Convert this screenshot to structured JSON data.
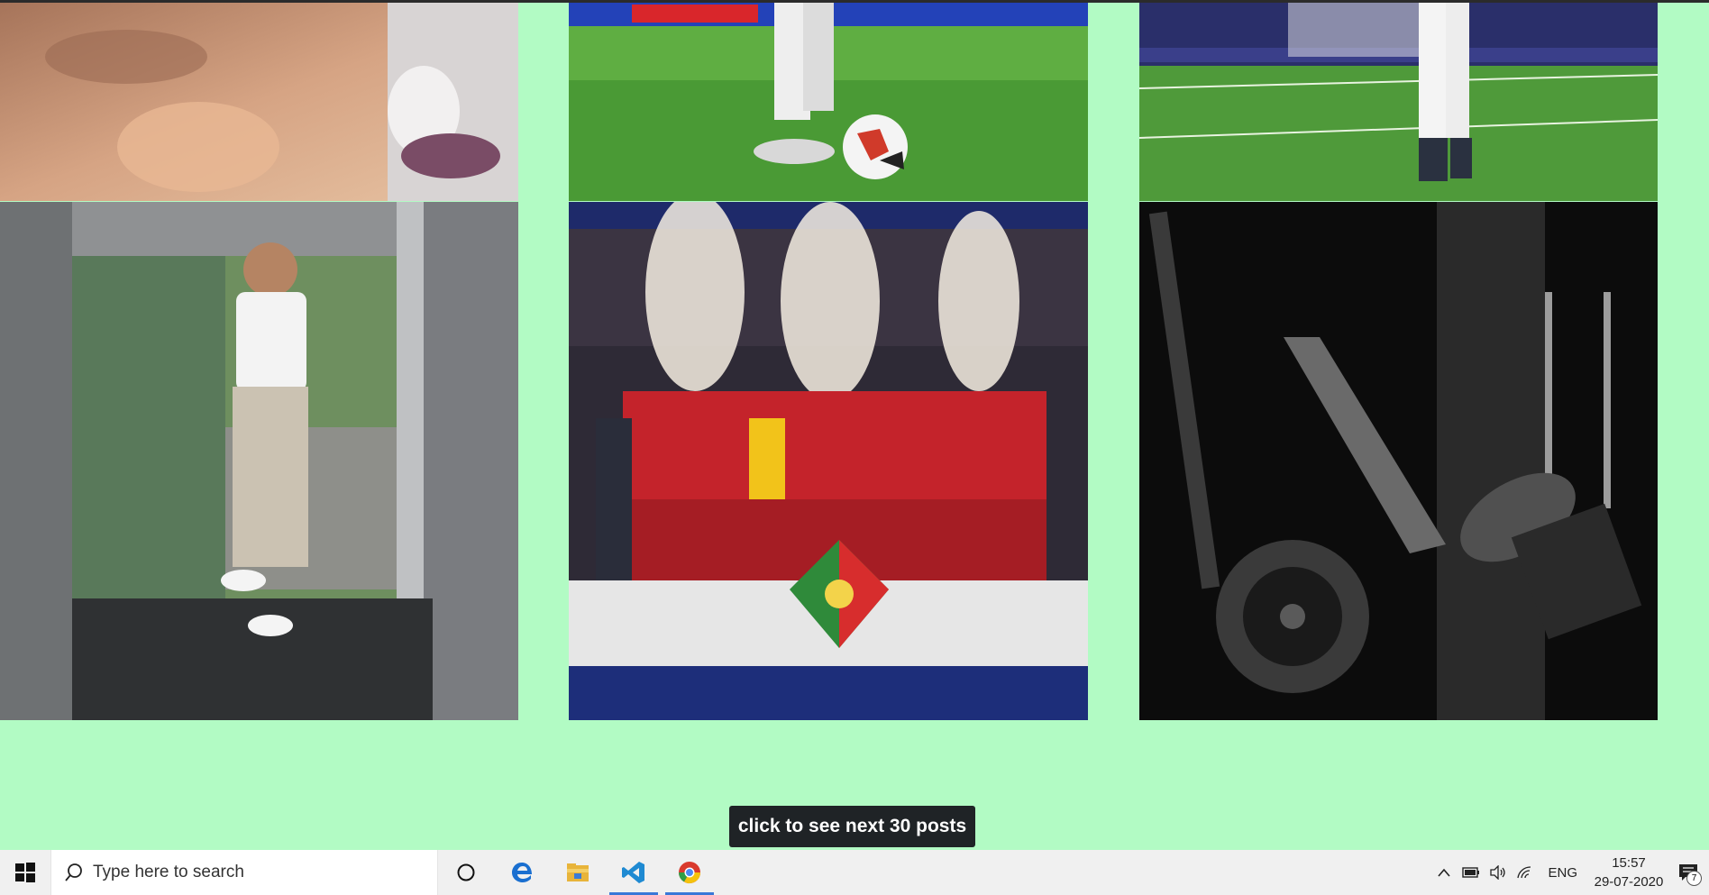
{
  "feed": {
    "posts": [
      {
        "alt": "shirtless selfie"
      },
      {
        "alt": "football at feet"
      },
      {
        "alt": "player on pitch"
      },
      {
        "alt": "smiling in elevator"
      },
      {
        "alt": "team trophy celebration"
      },
      {
        "alt": "gym leg press"
      }
    ],
    "next_button_label": "click to see next 30 posts"
  },
  "taskbar": {
    "search_placeholder": "Type here to search",
    "language": "ENG",
    "time": "15:57",
    "date": "29-07-2020",
    "notification_count": "7"
  }
}
